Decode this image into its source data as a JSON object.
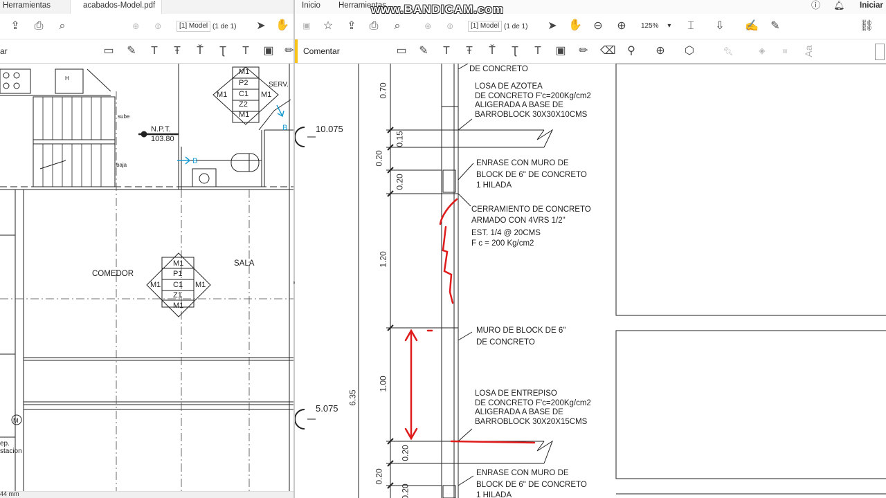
{
  "left_window": {
    "tabs": [
      "Herramientas",
      "acabados-Model.pdf"
    ],
    "tab_close": "×",
    "page_label": "[1] Model",
    "page_of": "(1 de 1)",
    "comment_partial": "ar",
    "status": "44 mm",
    "plan": {
      "rooms": [
        "COMEDOR",
        "SALA"
      ],
      "npt_label": "N.P.T.",
      "npt_value": "103.80",
      "serv": "SERV.",
      "b": "B",
      "h": "H",
      "m": "M",
      "sube": "sube",
      "baja": "baja",
      "dep1": "ep.",
      "dep2": "stacion",
      "diamond1": {
        "rows": [
          "M1",
          "P2",
          "C1",
          "Z2",
          "M1"
        ],
        "side": "M1"
      },
      "diamond2": {
        "rows": [
          "M1",
          "P1",
          "C1",
          "Z1",
          "M1"
        ],
        "side": "M1"
      }
    }
  },
  "right_window": {
    "menu": [
      "Inicio",
      "Herramientas"
    ],
    "account": "Iniciar",
    "page_label": "[1] Model",
    "page_of": "(1 de 1)",
    "zoom": "125%",
    "comment_label": "Comentar",
    "section": {
      "levels": [
        "10.075",
        "5.075"
      ],
      "dims": [
        "0.70",
        "0.20",
        "0.15",
        "0.20",
        "1.20",
        "1.00",
        "6.35",
        "0.20",
        "0.20",
        "0.20"
      ],
      "notes": [
        "DE CONCRETO",
        "LOSA DE AZOTEA",
        "DE CONCRETO F'c=200Kg/cm2",
        "ALIGERADA A BASE DE",
        "BARROBLOCK 30X30X10CMS",
        "ENRASE CON MURO DE",
        "BLOCK DE 6\" DE CONCRETO",
        "1 HILADA",
        "CERRAMIENTO DE CONCRETO",
        "ARMADO CON 4VRS 1/2\"",
        "EST. 1/4 @ 20CMS",
        "F c = 200 Kg/cm2",
        "MURO DE BLOCK DE 6\"",
        "DE CONCRETO",
        "LOSA DE ENTREPISO",
        "DE CONCRETO F'c=200Kg/cm2",
        "ALIGERADA A BASE DE",
        "BARROBLOCK 30X20X15CMS",
        "ENRASE CON MURO DE",
        "BLOCK DE 6\" DE CONCRETO",
        "1 HILADA"
      ]
    }
  },
  "watermark": "www.BANDICAM.com",
  "colors": {
    "annotation_red": "#e01b1b",
    "section_marker": "#1a9bd0"
  }
}
